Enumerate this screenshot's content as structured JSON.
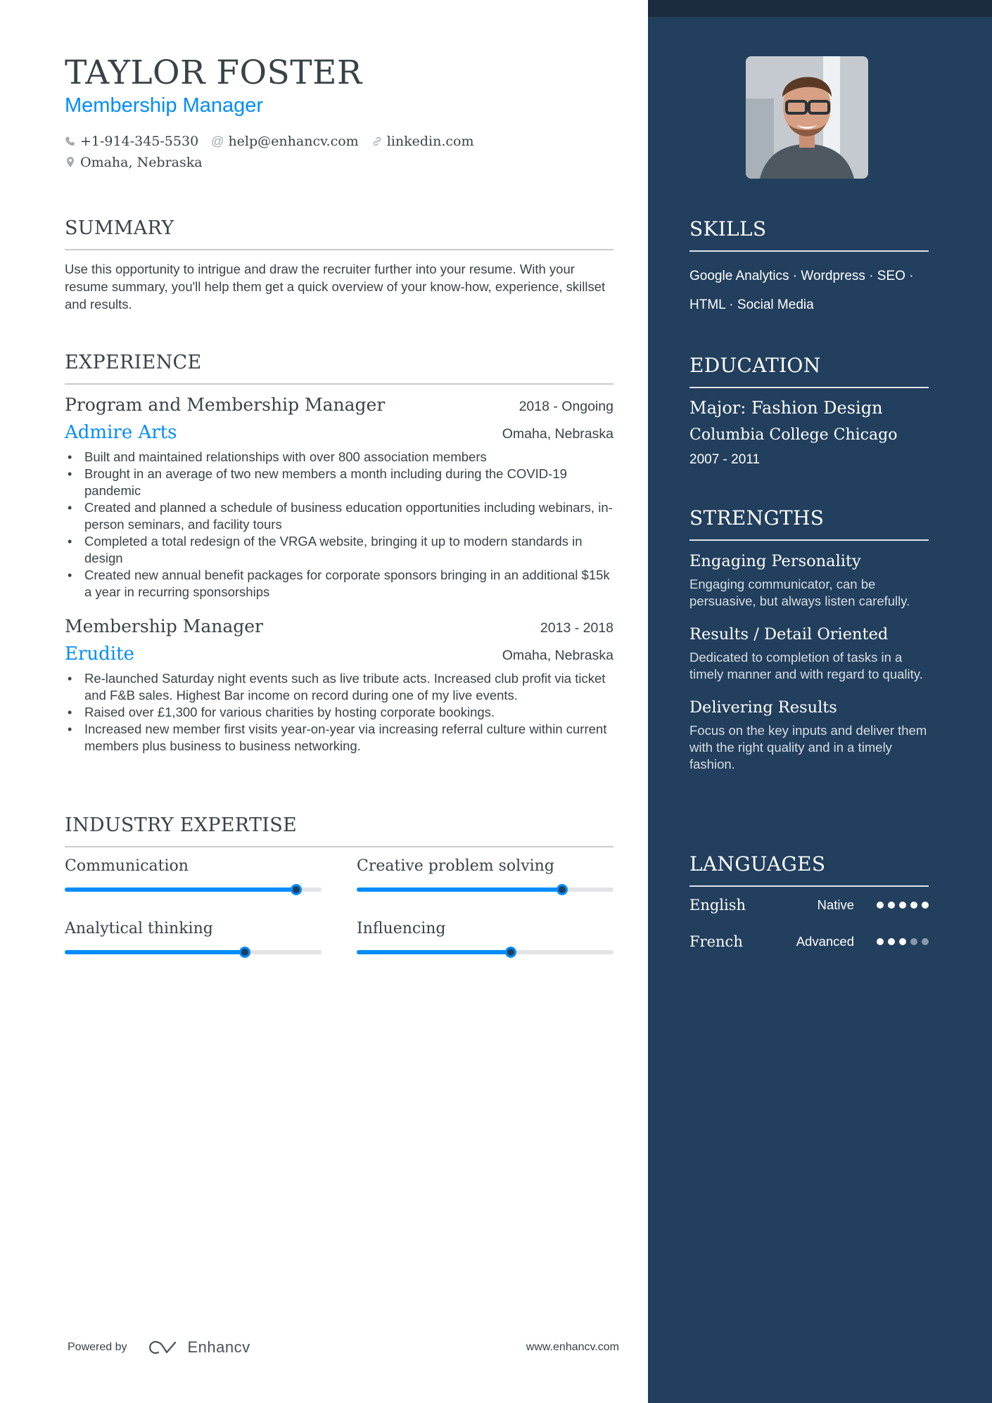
{
  "header": {
    "name": "TAYLOR FOSTER",
    "title": "Membership Manager",
    "contacts": {
      "phone": "+1-914-345-5530",
      "email": "help@enhancv.com",
      "link": "linkedin.com",
      "location": "Omaha, Nebraska"
    }
  },
  "summary": {
    "heading": "SUMMARY",
    "text": "Use this opportunity to intrigue and draw the recruiter further into your resume. With your resume summary, you'll help them get a quick overview of your know-how, experience, skillset and results."
  },
  "experience": {
    "heading": "EXPERIENCE",
    "jobs": [
      {
        "role": "Program and Membership Manager",
        "dates": "2018 - Ongoing",
        "company": "Admire Arts",
        "location": "Omaha, Nebraska",
        "bullets": [
          "Built and maintained relationships with over 800 association members",
          "Brought in an average of two new members a month including during the COVID-19 pandemic",
          "Created and planned a schedule of business education opportunities including webinars, in-person seminars, and facility tours",
          "Completed a total redesign of the VRGA website, bringing it up to modern standards in design",
          "Created new annual benefit packages for corporate sponsors bringing in an additional $15k a year in recurring sponsorships"
        ]
      },
      {
        "role": "Membership Manager",
        "dates": "2013 - 2018",
        "company": "Erudite",
        "location": "Omaha, Nebraska",
        "bullets": [
          "Re-launched Saturday night events such as live tribute acts. Increased club profit via ticket and F&B sales. Highest Bar income on record during one of my live events.",
          "Raised over £1,300 for various charities by hosting corporate bookings.",
          "Increased new member first visits year-on-year via increasing referral culture within current members plus business to business networking."
        ]
      }
    ]
  },
  "expertise": {
    "heading": "INDUSTRY EXPERTISE",
    "items": [
      {
        "label": "Communication",
        "level_percent": 90
      },
      {
        "label": "Creative problem solving",
        "level_percent": 80
      },
      {
        "label": "Analytical thinking",
        "level_percent": 70
      },
      {
        "label": "Influencing",
        "level_percent": 60
      }
    ]
  },
  "footer": {
    "powered_by": "Powered by",
    "brand": "Enhancv",
    "website": "www.enhancv.com"
  },
  "sidebar": {
    "skills": {
      "heading": "SKILLS",
      "line1": "Google Analytics · Wordpress · SEO ·",
      "line2": "HTML · Social Media"
    },
    "education": {
      "heading": "EDUCATION",
      "degree": "Major: Fashion Design",
      "school": "Columbia College Chicago",
      "dates": "2007 - 2011"
    },
    "strengths": {
      "heading": "STRENGTHS",
      "items": [
        {
          "title": "Engaging Personality",
          "desc": "Engaging communicator, can be persuasive, but always listen carefully."
        },
        {
          "title": "Results / Detail Oriented",
          "desc": "Dedicated to completion of tasks in a timely manner and with regard to quality."
        },
        {
          "title": "Delivering Results",
          "desc": "Focus on the key inputs and deliver them with the right quality and in a timely fashion."
        }
      ]
    },
    "languages": {
      "heading": "LANGUAGES",
      "items": [
        {
          "name": "English",
          "level": "Native",
          "dots_filled": 5,
          "dots_total": 5
        },
        {
          "name": "French",
          "level": "Advanced",
          "dots_filled": 3,
          "dots_total": 5
        }
      ]
    }
  },
  "colors": {
    "accent": "#008cff",
    "sidebar_bg": "#223f5d",
    "sidebar_topband": "#1a2b40",
    "text": "#384347"
  }
}
